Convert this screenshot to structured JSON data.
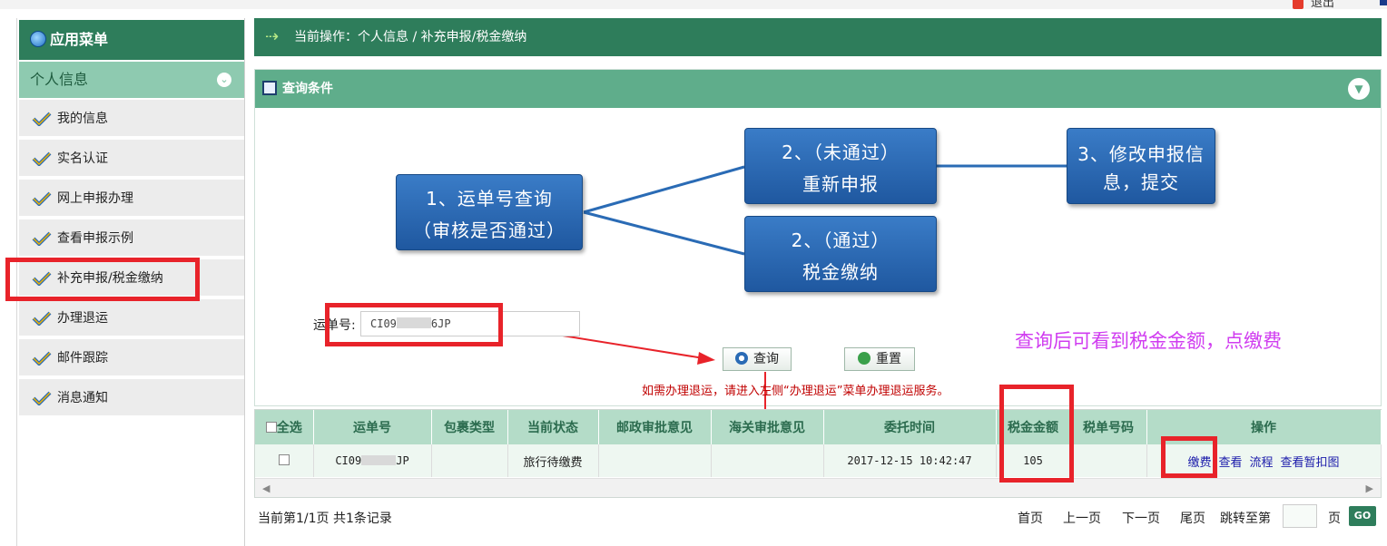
{
  "topbar": {
    "logout": "退出"
  },
  "sidebar": {
    "title": "应用菜单",
    "group": "个人信息",
    "items": [
      {
        "label": "我的信息"
      },
      {
        "label": "实名认证"
      },
      {
        "label": "网上申报办理"
      },
      {
        "label": "查看申报示例"
      },
      {
        "label": "补充申报/税金缴纳"
      },
      {
        "label": "办理退运"
      },
      {
        "label": "邮件跟踪"
      },
      {
        "label": "消息通知"
      }
    ]
  },
  "breadcrumb": "当前操作：个人信息 / 补充申报/税金缴纳",
  "query_panel": {
    "title": "查询条件",
    "flow": {
      "step1_line1": "1、运单号查询",
      "step1_line2": "（审核是否通过）",
      "step2a_line1": "2、（未通过）",
      "step2a_line2": "重新申报",
      "step2b_line1": "2、（通过）",
      "step2b_line2": "税金缴纳",
      "step3_line1": "3、修改申报信",
      "step3_line2": "息，提交"
    },
    "waybill_label": "运单号:",
    "waybill_value_prefix": "CI09",
    "waybill_value_suffix": "6JP",
    "search_button": "查询",
    "reset_button": "重置",
    "hint": "如需办理退运，请进入左侧“办理退运”菜单办理退运服务。",
    "annotation": "查询后可看到税金金额，点缴费"
  },
  "table": {
    "headers": [
      "全选",
      "运单号",
      "包裹类型",
      "当前状态",
      "邮政审批意见",
      "海关审批意见",
      "委托时间",
      "税金金额",
      "税单号码",
      "操作"
    ],
    "row": {
      "waybill_prefix": "CI09",
      "waybill_suffix": "JP",
      "package_type": "",
      "status": "旅行待缴费",
      "post_opinion": "",
      "customs_opinion": "",
      "time": "2017-12-15 10:42:47",
      "tax_amount": "105",
      "tax_no": "",
      "actions": [
        "缴费",
        "查看",
        "流程",
        "查看暂扣图"
      ]
    }
  },
  "pager": {
    "info": "当前第1/1页 共1条记录",
    "first": "首页",
    "prev": "上一页",
    "next": "下一页",
    "last": "尾页",
    "jump": "跳转至第",
    "page_unit": "页",
    "go": "GO"
  },
  "colors": {
    "header_green": "#2e7d5b",
    "panel_green": "#5fad8b",
    "sidebar_group": "#8ecab0",
    "flow_blue": "#2a6bb5",
    "highlight_red": "#e8232a",
    "annotation_magenta": "#d03cf0"
  }
}
